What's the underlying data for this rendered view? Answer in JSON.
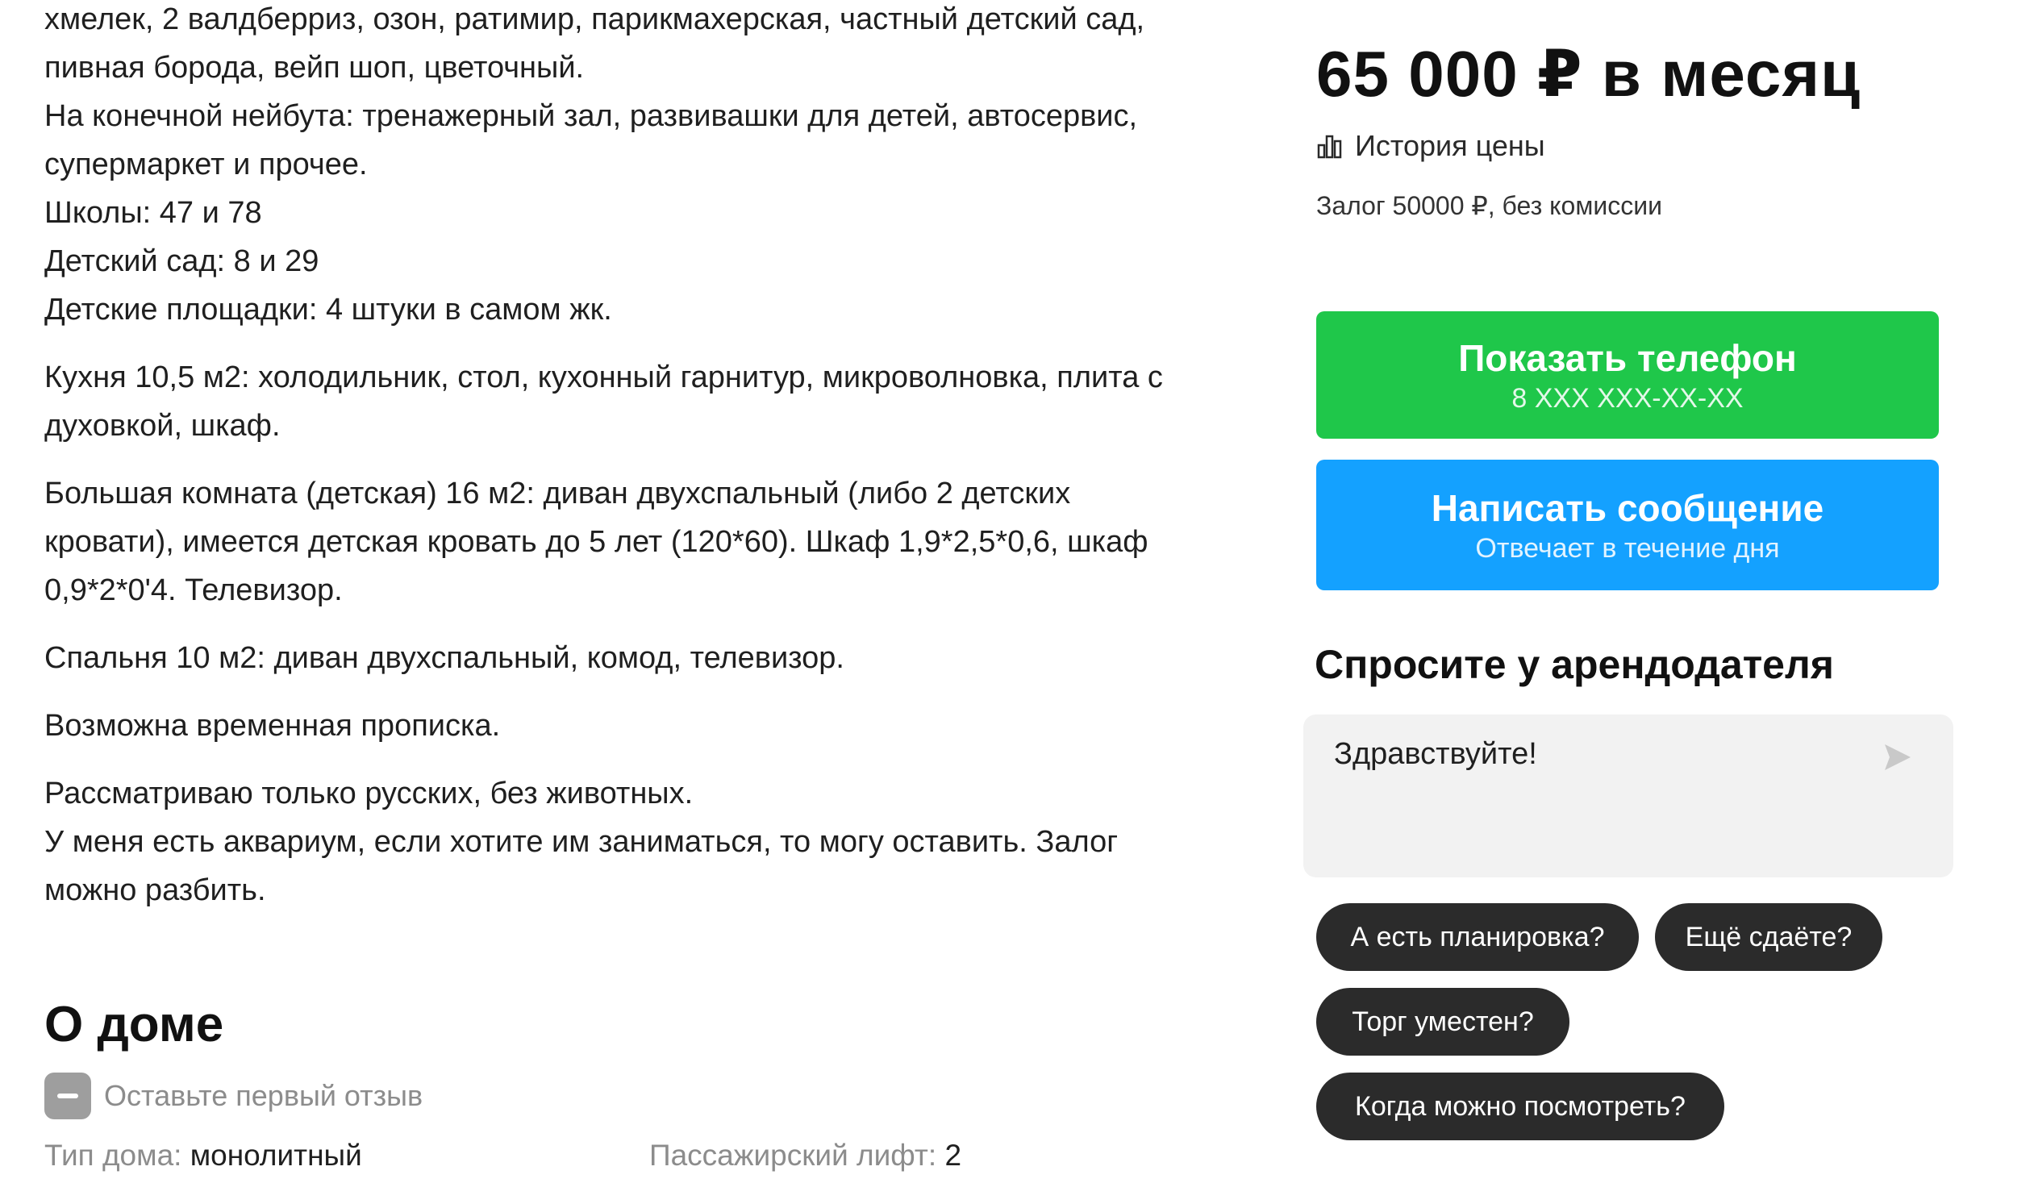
{
  "description": {
    "lines": [
      "хмелек, 2 валдберриз, озон, ратимир, парикмахерская, частный детский сад,",
      "пивная борода, вейп шоп, цветочный.",
      "На конечной нейбута: тренажерный зал, развивашки для детей, автосервис,",
      "супермаркет и прочее.",
      "Школы: 47 и 78",
      "Детский сад: 8 и 29",
      "Детские площадки: 4 штуки в самом жк.",
      "Кухня 10,5 м2: холодильник, стол, кухонный гарнитур, микроволновка, плита с",
      "духовкой, шкаф.",
      "Большая комната (детская) 16 м2: диван двухспальный (либо 2 детских",
      "кровати), имеется детская кровать до 5 лет (120*60). Шкаф 1,9*2,5*0,6, шкаф",
      "0,9*2*0'4. Телевизор.",
      "Спальня 10 м2: диван двухспальный, комод, телевизор.",
      "Возможна временная прописка.",
      "Рассматриваю только русских, без животных.",
      "У меня есть аквариум, если хотите им заниматься, то могу оставить. Залог",
      "можно разбить."
    ]
  },
  "about": {
    "title": "О доме",
    "review_link": "Оставьте первый отзыв",
    "house_type_label": "Тип дома:",
    "house_type_value": "монолитный",
    "lift_label": "Пассажирский лифт:",
    "lift_value": "2"
  },
  "sidebar": {
    "price": "65 000 ₽ в месяц",
    "price_history": "История цены",
    "deposit": "Залог 50000 ₽, без комиссии",
    "phone_button": {
      "label": "Показать телефон",
      "sub": "8 XXX XXX-XX-XX",
      "color": "#1fc74a"
    },
    "message_button": {
      "label": "Написать сообщение",
      "sub": "Отвечает в течение дня",
      "color": "#14a1ff"
    },
    "ask_title": "Спросите у арендодателя",
    "message_value": "Здравствуйте!",
    "quick_questions": [
      "А есть планировка?",
      "Ещё сдаёте?",
      "Торг уместен?",
      "Когда можно посмотреть?"
    ]
  },
  "icons": [
    "chart-bars-icon",
    "minus-badge-icon",
    "send-arrow-icon"
  ]
}
